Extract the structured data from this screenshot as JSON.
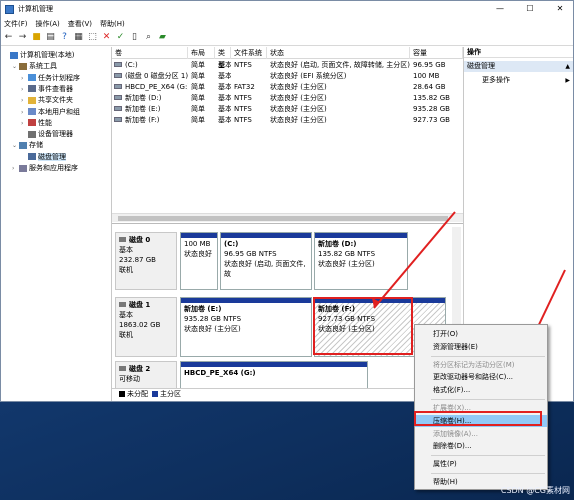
{
  "window": {
    "title": "计算机管理",
    "min": "—",
    "max": "☐",
    "close": "✕"
  },
  "menu": [
    "文件(F)",
    "操作(A)",
    "查看(V)",
    "帮助(H)"
  ],
  "tree": [
    {
      "label": "计算机管理(本地)",
      "level": 0,
      "expander": "",
      "icon": "computer-icon"
    },
    {
      "label": "系统工具",
      "level": 1,
      "expander": "⌄",
      "icon": "tools-icon"
    },
    {
      "label": "任务计划程序",
      "level": 2,
      "expander": "›",
      "icon": "clock-icon"
    },
    {
      "label": "事件查看器",
      "level": 2,
      "expander": "›",
      "icon": "event-icon"
    },
    {
      "label": "共享文件夹",
      "level": 2,
      "expander": "›",
      "icon": "folder-icon"
    },
    {
      "label": "本地用户和组",
      "level": 2,
      "expander": "›",
      "icon": "users-icon"
    },
    {
      "label": "性能",
      "level": 2,
      "expander": "›",
      "icon": "performance-icon"
    },
    {
      "label": "设备管理器",
      "level": 2,
      "expander": "",
      "icon": "device-icon"
    },
    {
      "label": "存储",
      "level": 1,
      "expander": "⌄",
      "icon": "storage-icon"
    },
    {
      "label": "磁盘管理",
      "level": 2,
      "expander": "",
      "icon": "disk-icon",
      "selected": true
    },
    {
      "label": "服务和应用程序",
      "level": 1,
      "expander": "›",
      "icon": "services-icon"
    }
  ],
  "columns": [
    "卷",
    "布局",
    "类型",
    "文件系统",
    "状态",
    "容量"
  ],
  "volumes": [
    {
      "name": "(C:)",
      "layout": "简单",
      "type": "基本",
      "fs": "NTFS",
      "status": "状态良好 (启动, 页面文件, 故障转储, 主分区)",
      "cap": "96.95 GB"
    },
    {
      "name": "(磁盘 0 磁盘分区 1)",
      "layout": "简单",
      "type": "基本",
      "fs": "",
      "status": "状态良好 (EFI 系统分区)",
      "cap": "100 MB"
    },
    {
      "name": "HBCD_PE_X64 (G:)",
      "layout": "简单",
      "type": "基本",
      "fs": "FAT32",
      "status": "状态良好 (主分区)",
      "cap": "28.64 GB"
    },
    {
      "name": "新加卷 (D:)",
      "layout": "简单",
      "type": "基本",
      "fs": "NTFS",
      "status": "状态良好 (主分区)",
      "cap": "135.82 GB"
    },
    {
      "name": "新加卷 (E:)",
      "layout": "简单",
      "type": "基本",
      "fs": "NTFS",
      "status": "状态良好 (主分区)",
      "cap": "935.28 GB"
    },
    {
      "name": "新加卷 (F:)",
      "layout": "简单",
      "type": "基本",
      "fs": "NTFS",
      "status": "状态良好 (主分区)",
      "cap": "927.73 GB"
    }
  ],
  "disks": [
    {
      "name": "磁盘 0",
      "type": "基本",
      "size": "232.87 GB",
      "state": "联机",
      "parts": [
        {
          "title": "",
          "size": "100 MB",
          "status": "状态良好"
        },
        {
          "title": "(C:)",
          "size": "96.95 GB NTFS",
          "status": "状态良好 (启动, 页面文件, 故"
        },
        {
          "title": "新加卷 (D:)",
          "size": "135.82 GB NTFS",
          "status": "状态良好 (主分区)"
        }
      ]
    },
    {
      "name": "磁盘 1",
      "type": "基本",
      "size": "1863.02 GB",
      "state": "联机",
      "parts": [
        {
          "title": "新加卷 (E:)",
          "size": "935.28 GB NTFS",
          "status": "状态良好 (主分区)"
        },
        {
          "title": "新加卷 (F:)",
          "size": "927.73 GB NTFS",
          "status": "状态良好 (主分区)"
        }
      ]
    },
    {
      "name": "磁盘 2",
      "type": "可移动",
      "size": "",
      "state": "",
      "parts": [
        {
          "title": "HBCD_PE_X64 (G:)",
          "size": "",
          "status": ""
        }
      ]
    }
  ],
  "legend": [
    "未分配",
    "主分区"
  ],
  "actions": {
    "header": "操作",
    "section": "磁盘管理",
    "more": "更多操作",
    "expander": "▲",
    "more_arrow": "▶"
  },
  "context_menu": [
    {
      "label": "打开(O)",
      "disabled": false
    },
    {
      "label": "资源管理器(E)",
      "disabled": false
    },
    {
      "sep": true
    },
    {
      "label": "将分区标记为活动分区(M)",
      "disabled": true
    },
    {
      "label": "更改驱动器号和路径(C)...",
      "disabled": false
    },
    {
      "label": "格式化(F)...",
      "disabled": false
    },
    {
      "sep": true
    },
    {
      "label": "扩展卷(X)...",
      "disabled": true
    },
    {
      "label": "压缩卷(H)...",
      "disabled": false,
      "highlighted": true
    },
    {
      "label": "添加镜像(A)...",
      "disabled": true
    },
    {
      "label": "删除卷(D)...",
      "disabled": false
    },
    {
      "sep": true
    },
    {
      "label": "属性(P)",
      "disabled": false
    },
    {
      "sep": true
    },
    {
      "label": "帮助(H)",
      "disabled": false
    }
  ],
  "watermark": "CSDN @CG素材网",
  "colors": {
    "primary_partition": "#1a3a9a",
    "unallocated": "#000000",
    "highlight_box": "#e02020",
    "annotation_arrow": "#e02020",
    "menu_highlight": "#91c9f7"
  }
}
